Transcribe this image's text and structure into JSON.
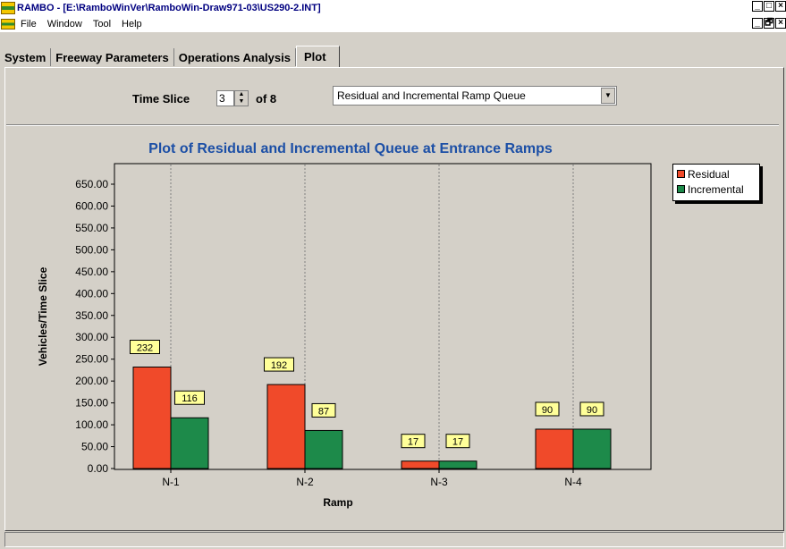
{
  "window": {
    "title": "RAMBO - [E:\\RamboWinVer\\RamboWin-Draw971-03\\US290-2.INT]",
    "buttons": [
      "_",
      "□",
      "×"
    ],
    "mdi_buttons": [
      "_",
      "🗗",
      "×"
    ]
  },
  "menu": {
    "file": "File",
    "window": "Window",
    "tool": "Tool",
    "help": "Help"
  },
  "tabs": [
    "System",
    "Freeway Parameters",
    "Operations Analysis",
    "Plot"
  ],
  "controls": {
    "time_slice_label": "Time Slice",
    "time_slice_value": "3",
    "of_label": "of 8",
    "plot_type": "Residual and Incremental Ramp Queue"
  },
  "chart_data": {
    "type": "bar",
    "title": "Plot of Residual and Incremental Queue at Entrance Ramps",
    "xlabel": "Ramp",
    "ylabel": "Vehicles/Time Slice",
    "categories": [
      "N-1",
      "N-2",
      "N-3",
      "N-4"
    ],
    "series": [
      {
        "name": "Residual",
        "color": "#f04a2a",
        "values": [
          232,
          192,
          17,
          90
        ]
      },
      {
        "name": "Incremental",
        "color": "#1d8a4a",
        "values": [
          116,
          87,
          17,
          90
        ]
      }
    ],
    "ylim": [
      0,
      650
    ],
    "yticks": [
      "0.00",
      "50.00",
      "100.00",
      "150.00",
      "200.00",
      "250.00",
      "300.00",
      "350.00",
      "400.00",
      "450.00",
      "500.00",
      "550.00",
      "600.00",
      "650.00"
    ],
    "legend": "top-right",
    "grid": "vertical-dashed"
  }
}
